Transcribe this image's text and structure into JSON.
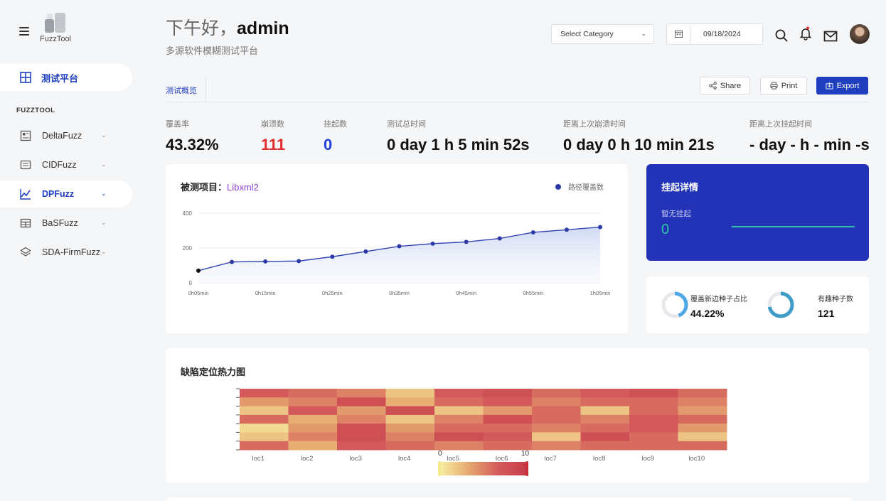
{
  "app": {
    "name": "FuzzTool"
  },
  "header": {
    "greeting_prefix": "下午好，",
    "greeting_user": "admin",
    "subtitle": "多源软件模糊测试平台",
    "category_select": "Select Category",
    "date": "09/18/2024"
  },
  "sidebar": {
    "main_item": "测试平台",
    "section_label": "FUZZTOOL",
    "items": [
      {
        "label": "DeltaFuzz",
        "icon": "grid-icon"
      },
      {
        "label": "CIDFuzz",
        "icon": "doc-icon"
      },
      {
        "label": "DPFuzz",
        "icon": "chart-line-icon",
        "active": true
      },
      {
        "label": "BaSFuzz",
        "icon": "table-icon"
      },
      {
        "label": "SDA-FirmFuzz",
        "icon": "layers-icon"
      }
    ]
  },
  "tabs": {
    "active": "测试概览"
  },
  "actions": {
    "share": "Share",
    "print": "Print",
    "export": "Export"
  },
  "metrics": [
    {
      "label": "覆盖率",
      "value": "43.32%",
      "color": "#111111"
    },
    {
      "label": "崩溃数",
      "value": "111",
      "color": "#e02c2c"
    },
    {
      "label": "挂起数",
      "value": "0",
      "color": "#1f3fd6"
    },
    {
      "label": "测试总时间",
      "value": "0 day 1 h 5 min 52s",
      "color": "#111111"
    },
    {
      "label": "距离上次崩溃时间",
      "value": "0 day 0 h 10 min 21s",
      "color": "#111111"
    },
    {
      "label": "距离上次挂起时间",
      "value": "- day - h - min -s",
      "color": "#111111"
    }
  ],
  "coverage_chart": {
    "title_prefix": "被测项目：",
    "project": "Libxml2",
    "legend": "路径覆盖数"
  },
  "hang_panel": {
    "title": "挂起详情",
    "subtitle": "暂无挂起",
    "value": "0"
  },
  "donuts": [
    {
      "label": "覆盖新边种子占比",
      "value": "44.22%",
      "fraction": 0.4422,
      "color": "#4ea8e8"
    },
    {
      "label": "有趣种子数",
      "value": "121",
      "fraction": 0.72,
      "color": "#3f9bc7"
    }
  ],
  "heatmap": {
    "title": "缺陷定位热力图",
    "scale_min": "0",
    "scale_max": "10"
  },
  "chart_data": [
    {
      "type": "line",
      "x": [
        "0h05min",
        "0h10min",
        "0h15min",
        "0h20min",
        "0h25min",
        "0h30min",
        "0h35min",
        "0h40min",
        "0h45min",
        "0h50min",
        "0h55min",
        "1h00min",
        "1h05min"
      ],
      "x_tick_labels": [
        "0h05min",
        "0h15min",
        "0h25min",
        "0h35min",
        "0h45min",
        "0h55min",
        "1h05min"
      ],
      "series": [
        {
          "name": "路径覆盖数",
          "values": [
            70,
            120,
            123,
            125,
            150,
            180,
            210,
            225,
            235,
            255,
            290,
            305,
            320
          ]
        }
      ],
      "ylim": [
        0,
        400
      ],
      "y_ticks": [
        0,
        200,
        400
      ],
      "grid": true,
      "legend": "top-right"
    },
    {
      "type": "heatmap",
      "categories": [
        "loc1",
        "loc2",
        "loc3",
        "loc4",
        "loc5",
        "loc6",
        "loc7",
        "loc8",
        "loc9",
        "loc10"
      ],
      "rows": 7,
      "values": [
        [
          7,
          6,
          5,
          2,
          7,
          8,
          6,
          7,
          8,
          6
        ],
        [
          4,
          5,
          8,
          3,
          6,
          7,
          5,
          6,
          6,
          5
        ],
        [
          2,
          7,
          4,
          8,
          2,
          4,
          6,
          2,
          6,
          4
        ],
        [
          6,
          3,
          5,
          2,
          5,
          8,
          6,
          5,
          7,
          6
        ],
        [
          1,
          4,
          8,
          4,
          6,
          6,
          5,
          6,
          7,
          4
        ],
        [
          2,
          5,
          8,
          5,
          8,
          7,
          2,
          8,
          6,
          2
        ],
        [
          6,
          3,
          7,
          6,
          5,
          6,
          5,
          6,
          6,
          6
        ]
      ],
      "scale": [
        0,
        10
      ]
    }
  ]
}
